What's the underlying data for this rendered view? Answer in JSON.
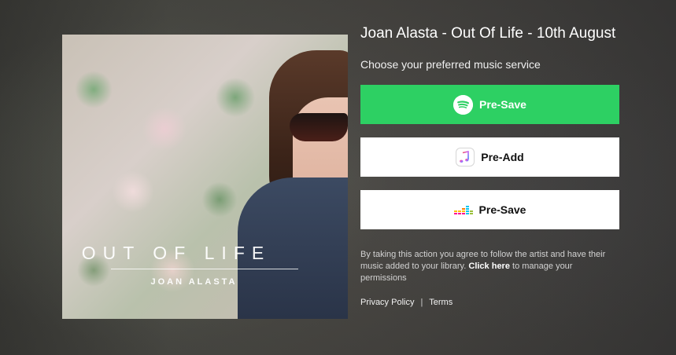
{
  "release": {
    "title": "Joan Alasta - Out Of Life - 10th August",
    "subtitle": "Choose your preferred music service"
  },
  "cover": {
    "title": "OUT OF LIFE",
    "artist": "JOAN ALASTA"
  },
  "services": [
    {
      "name": "spotify",
      "icon": "spotify-icon",
      "label": "Pre-Save",
      "color": "#2DD063"
    },
    {
      "name": "apple-music",
      "icon": "apple-music-icon",
      "label": "Pre-Add",
      "color": "#FFFFFF"
    },
    {
      "name": "deezer",
      "icon": "deezer-icon",
      "label": "Pre-Save",
      "color": "#FFFFFF"
    }
  ],
  "legal": {
    "text_before": "By taking this action you agree to follow the artist and have their music added to your library.",
    "link": "Click here",
    "text_after": "to manage your permissions"
  },
  "footer": {
    "privacy": "Privacy Policy",
    "separator": "|",
    "terms": "Terms"
  }
}
